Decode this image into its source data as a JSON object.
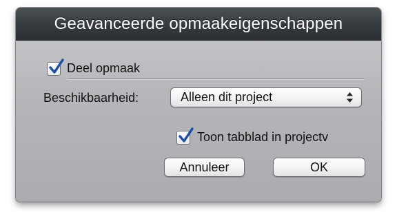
{
  "dialog": {
    "title": "Geavanceerde opmaakeigenschappen",
    "share_format": {
      "label": "Deel opmaak",
      "checked": true
    },
    "availability": {
      "label": "Beschikbaarheid:",
      "selected": "Alleen dit project"
    },
    "show_tab": {
      "label": "Toon tabblad in projectv",
      "checked": true
    },
    "buttons": {
      "cancel": "Annuleer",
      "ok": "OK"
    }
  },
  "icons": {
    "checkmark": "checkmark-icon",
    "select_arrows": "up-down-arrows-icon"
  },
  "colors": {
    "titlebar": "#353a3e",
    "panel": "#b6b7ba",
    "checkmark": "#1c4fa8"
  }
}
